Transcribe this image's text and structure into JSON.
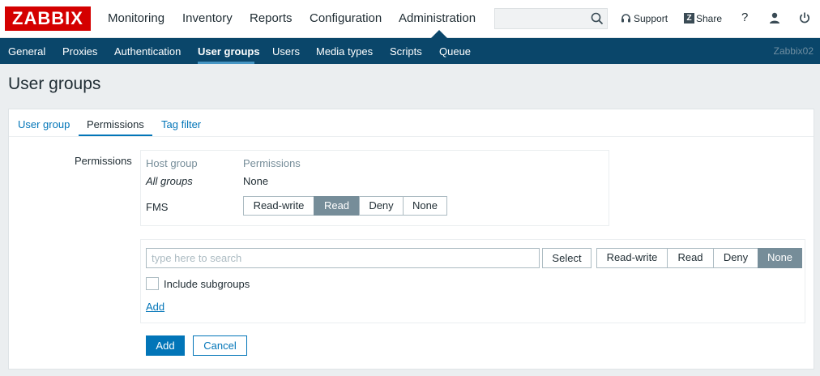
{
  "app": {
    "logo": "ZABBIX",
    "server_name": "Zabbix02"
  },
  "main_menu": [
    {
      "label": "Monitoring"
    },
    {
      "label": "Inventory"
    },
    {
      "label": "Reports"
    },
    {
      "label": "Configuration"
    },
    {
      "label": "Administration",
      "active": true
    }
  ],
  "header": {
    "search_placeholder": "",
    "support_label": "Support",
    "share_label": "Share",
    "help_label": "?",
    "icons": [
      "search-icon",
      "headset-icon",
      "share-icon",
      "help-icon",
      "user-icon",
      "power-icon"
    ]
  },
  "sub_menu": [
    {
      "label": "General"
    },
    {
      "label": "Proxies"
    },
    {
      "label": "Authentication"
    },
    {
      "label": "User groups",
      "active": true
    },
    {
      "label": "Users"
    },
    {
      "label": "Media types"
    },
    {
      "label": "Scripts"
    },
    {
      "label": "Queue"
    }
  ],
  "page": {
    "title": "User groups"
  },
  "tabs": [
    {
      "label": "User group"
    },
    {
      "label": "Permissions",
      "active": true
    },
    {
      "label": "Tag filter"
    }
  ],
  "permissions": {
    "label": "Permissions",
    "columns": [
      "Host group",
      "Permissions"
    ],
    "rows": [
      {
        "group": "All groups",
        "permission": "None"
      },
      {
        "group": "FMS",
        "options": [
          "Read-write",
          "Read",
          "Deny",
          "None"
        ],
        "selected": "Read"
      }
    ]
  },
  "picker": {
    "search_placeholder": "type here to search",
    "select_label": "Select",
    "options": [
      "Read-write",
      "Read",
      "Deny",
      "None"
    ],
    "selected": "None",
    "include_subgroups_label": "Include subgroups",
    "include_subgroups_checked": false,
    "add_link": "Add"
  },
  "form_buttons": {
    "add": "Add",
    "cancel": "Cancel"
  },
  "colors": {
    "brand_red": "#d40000",
    "nav_blue": "#0a466a",
    "link_blue": "#0275b8",
    "selected_gray": "#768d99"
  }
}
